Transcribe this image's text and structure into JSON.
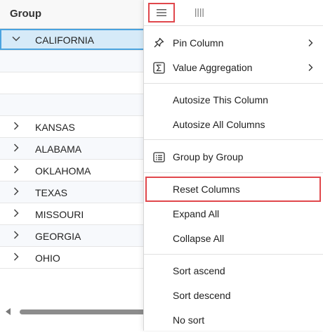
{
  "grid": {
    "column_header": "Group",
    "rows": [
      {
        "label": "CALIFORNIA",
        "expanded": true,
        "selected": true
      },
      {
        "label": ""
      },
      {
        "label": ""
      },
      {
        "label": ""
      },
      {
        "label": "KANSAS",
        "expanded": false
      },
      {
        "label": "ALABAMA",
        "expanded": false
      },
      {
        "label": "OKLAHOMA",
        "expanded": false
      },
      {
        "label": "TEXAS",
        "expanded": false
      },
      {
        "label": "MISSOURI",
        "expanded": false
      },
      {
        "label": "GEORGIA",
        "expanded": false
      },
      {
        "label": "OHIO",
        "expanded": false
      }
    ]
  },
  "menu": {
    "tabs": [
      {
        "icon": "hamburger-menu-icon",
        "active": true
      },
      {
        "icon": "columns-icon",
        "active": false
      }
    ],
    "items": {
      "pin_column": "Pin Column",
      "value_aggregation": "Value Aggregation",
      "autosize_this": "Autosize This Column",
      "autosize_all": "Autosize All Columns",
      "group_by": "Group by Group",
      "reset_columns": "Reset Columns",
      "expand_all": "Expand All",
      "collapse_all": "Collapse All",
      "sort_ascend": "Sort ascend",
      "sort_descend": "Sort descend",
      "no_sort": "No sort"
    }
  },
  "colors": {
    "highlight": "#e0474c",
    "selected_row": "#d6eaf8",
    "selected_border": "#4aa3df"
  }
}
